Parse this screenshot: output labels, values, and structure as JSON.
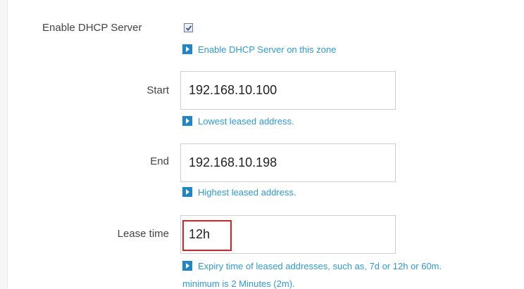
{
  "dhcp": {
    "enable_label": "Enable DHCP Server",
    "enable_checked": true,
    "enable_help": "Enable DHCP Server on this zone"
  },
  "start": {
    "label": "Start",
    "value": "192.168.10.100",
    "help": "Lowest leased address."
  },
  "end": {
    "label": "End",
    "value": "192.168.10.198",
    "help": "Highest leased address."
  },
  "lease": {
    "label": "Lease time",
    "value": "12h",
    "help_line1": "Expiry time of leased addresses, such as, 7d or 12h or 60m.",
    "help_line2": "minimum is 2 Minutes (2m)."
  },
  "colors": {
    "help_text": "#2e9ad6",
    "help_icon": "#1f86c9",
    "highlight_border": "#dd2222"
  },
  "icons": {
    "help": "play-arrow-icon",
    "checkbox": "checkmark-icon"
  }
}
